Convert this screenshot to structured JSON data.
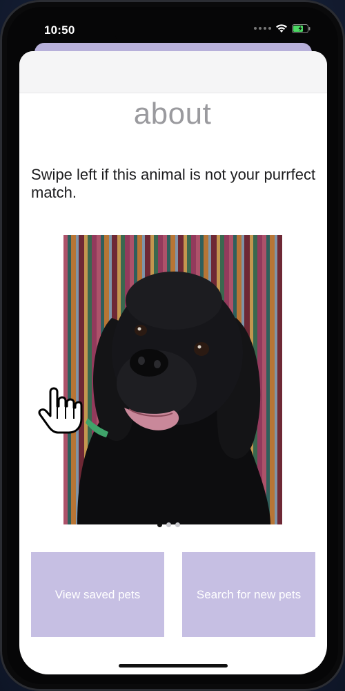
{
  "status_bar": {
    "time": "10:50"
  },
  "page": {
    "title": "about",
    "instruction": "Swipe left if this animal is not your purrfect match."
  },
  "pet_carousel": {
    "page_count": 3,
    "current_page": 1
  },
  "actions": {
    "view_saved_label": "View saved pets",
    "search_new_label": "Search for new pets"
  },
  "colors": {
    "button_bg": "#c6bfe3",
    "sheet_top": "#b7b0da",
    "title": "#9a9a9e"
  },
  "icons": [
    "wifi-icon",
    "battery-icon",
    "hand-cursor-icon"
  ]
}
